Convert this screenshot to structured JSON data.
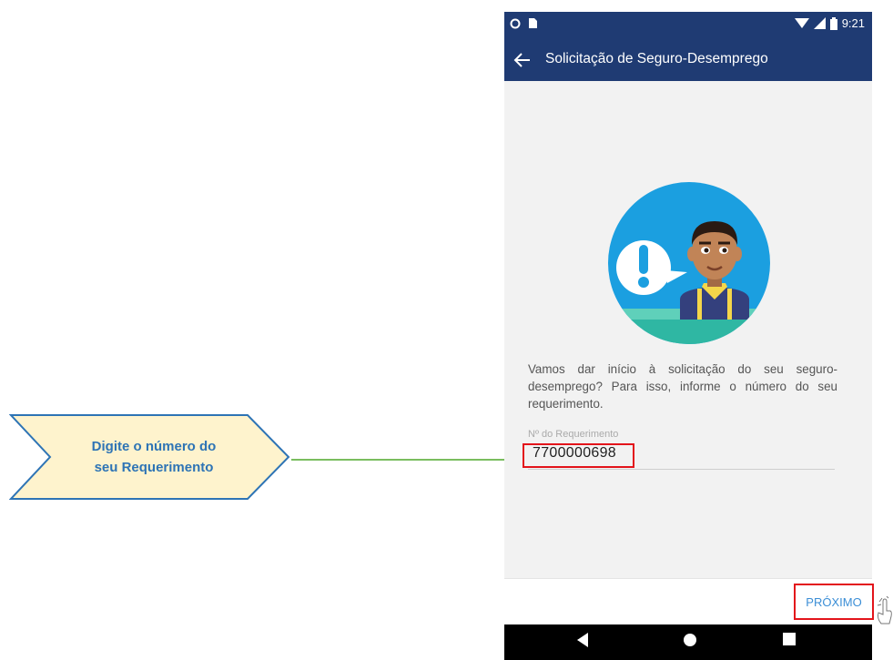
{
  "callout": {
    "line1": "Digite o número do",
    "line2": "seu Requerimento"
  },
  "status_bar": {
    "time": "9:21",
    "icons": [
      "circle-icon",
      "sim-icon",
      "wifi-icon",
      "signal-icon",
      "battery-icon"
    ]
  },
  "app_bar": {
    "title": "Solicitação de Seguro-Desemprego",
    "back_icon": "arrow-left-icon"
  },
  "main": {
    "intro": "Vamos dar início à solicitação do seu seguro-desemprego? Para isso, informe o número do seu requerimento.",
    "field_label": "Nº do Requerimento",
    "field_value": "7700000698"
  },
  "footer": {
    "next_label": "PRÓXIMO"
  },
  "nav": {
    "icons": [
      "nav-back-icon",
      "nav-home-icon",
      "nav-recent-icon"
    ]
  },
  "colors": {
    "app_bar": "#1f3b73",
    "highlight": "#e3141b",
    "button_text": "#3b8ed6",
    "callout_fill": "#fef3cd",
    "callout_border": "#2e74b5",
    "arrow": "#4ea72a"
  }
}
